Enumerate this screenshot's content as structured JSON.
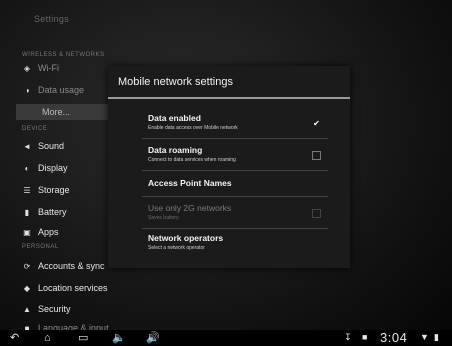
{
  "app": {
    "title": "Settings"
  },
  "sidebar": {
    "sections": {
      "wireless": "WIRELESS & NETWORKS",
      "device": "DEVICE",
      "personal": "PERSONAL"
    },
    "items": [
      {
        "label": "Wi-Fi",
        "icon": "wifi-icon"
      },
      {
        "label": "Data usage",
        "icon": "data-usage-icon"
      },
      {
        "label": "More...",
        "icon": ""
      },
      {
        "label": "Sound",
        "icon": "sound-icon"
      },
      {
        "label": "Display",
        "icon": "display-icon"
      },
      {
        "label": "Storage",
        "icon": "storage-icon"
      },
      {
        "label": "Battery",
        "icon": "battery-icon"
      },
      {
        "label": "Apps",
        "icon": "apps-icon"
      },
      {
        "label": "Accounts & sync",
        "icon": "sync-icon"
      },
      {
        "label": "Location services",
        "icon": "location-icon"
      },
      {
        "label": "Security",
        "icon": "lock-icon"
      },
      {
        "label": "Language & input",
        "icon": "language-icon"
      }
    ]
  },
  "dialog": {
    "title": "Mobile network settings",
    "options": [
      {
        "label": "Data enabled",
        "sub": "Enable data access over Mobile network",
        "checked": true,
        "enabled": true
      },
      {
        "label": "Data roaming",
        "sub": "Connect to data services when roaming",
        "checked": false,
        "enabled": true
      },
      {
        "label": "Access Point Names",
        "sub": "",
        "enabled": true
      },
      {
        "label": "Use only 2G networks",
        "sub": "Saves battery",
        "checked": false,
        "enabled": false
      },
      {
        "label": "Network operators",
        "sub": "Select a network operator",
        "enabled": true
      }
    ]
  },
  "statusbar": {
    "time": "3:04",
    "icons": [
      "back-icon",
      "home-icon",
      "recent-apps-icon",
      "volume-down-icon",
      "volume-up-icon"
    ]
  },
  "colors": {
    "background": "#141414",
    "dialog": "#1b1b1b",
    "accent": "#9a9a9a"
  }
}
